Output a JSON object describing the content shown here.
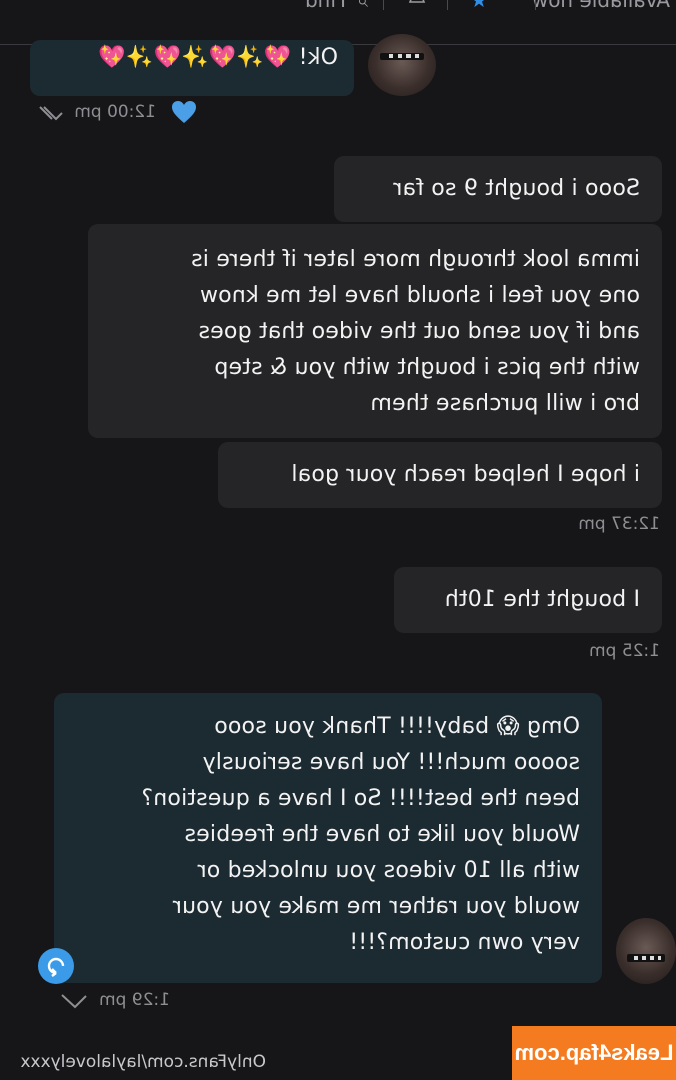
{
  "topbar": {
    "status": "Available now",
    "find": "Find",
    "search_icon": "search-icon",
    "bell_icon": "bell-icon",
    "star_icon": "star-icon"
  },
  "messages": [
    {
      "side": "in",
      "lines": [
        "Ok! 💖✨💖✨💖✨💖"
      ],
      "time": "12:00 pm",
      "liked": true
    },
    {
      "side": "out",
      "lines": [
        "Sooo i bought 9 so far"
      ]
    },
    {
      "side": "out",
      "lines": [
        "imma look through more later if there is",
        "one you feel i should have let me know",
        "and if you send out the video that goes",
        "with the pics i bought with you & step",
        "bro i will purchase them"
      ]
    },
    {
      "side": "out",
      "lines": [
        "i hope I helped reach your goal"
      ],
      "time": "12:37 pm"
    },
    {
      "side": "out",
      "lines": [
        "I bought the 10th"
      ],
      "time": "1:25 pm"
    },
    {
      "side": "in",
      "lines": [
        "Omg 😱 baby!!!! Thank you sooo",
        "soooo much!!! You have seriously",
        "been the best!!!! So I have a question?",
        "Would you like to have the freebies",
        "with all 10 videos you unlocked or",
        "would you rather me make you your",
        "very own custom?!!!"
      ],
      "time": "1:29 pm"
    }
  ],
  "footer": {
    "url": "OnlyFans.com/laylalovelyxxx",
    "brand": "Leaks4fap.com"
  },
  "colors": {
    "background": "#161618",
    "outgoing_bubble": "#252527",
    "incoming_bubble": "#1c2a31",
    "like_heart": "#4a9fe6",
    "brand": "#f47b20"
  }
}
